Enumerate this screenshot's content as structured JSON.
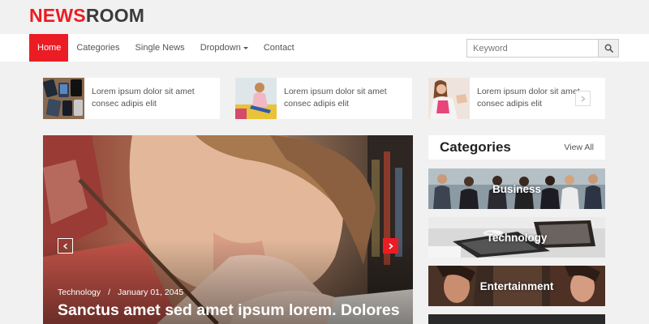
{
  "brand": {
    "part1": "NEWS",
    "part2": "ROOM"
  },
  "nav": {
    "items": [
      "Home",
      "Categories",
      "Single News",
      "Dropdown",
      "Contact"
    ]
  },
  "search": {
    "placeholder": "Keyword"
  },
  "ticker": {
    "items": [
      {
        "line1": "Lorem ipsum dolor sit amet",
        "line2": "consec adipis elit"
      },
      {
        "line1": "Lorem ipsum dolor sit amet",
        "line2": "consec adipis elit"
      },
      {
        "line1": "Lorem ipsum dolor sit amet",
        "line2": "consec adipis elit"
      }
    ]
  },
  "hero": {
    "category": "Technology",
    "separator": "/",
    "date": "January 01, 2045",
    "title": "Sanctus amet sed amet ipsum lorem. Dolores"
  },
  "categories": {
    "title": "Categories",
    "view_all": "View All",
    "items": [
      "Business",
      "Technology",
      "Entertainment"
    ]
  },
  "colors": {
    "accent": "#ec1c24",
    "dark": "#3b3b3b"
  },
  "icons": {
    "search": "search-icon",
    "next": "chevron-right-icon",
    "prev": "chevron-left-icon"
  }
}
